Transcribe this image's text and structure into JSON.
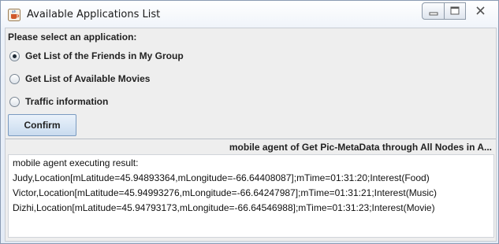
{
  "window": {
    "title": "Available Applications List",
    "icons": {
      "app": "java-coffee-cup-icon",
      "minimize": "minimize-icon",
      "maximize": "maximize-icon",
      "close": "close-icon"
    }
  },
  "form": {
    "prompt": "Please select an application:",
    "options": [
      {
        "label": "Get List of the Friends in My Group",
        "selected": true
      },
      {
        "label": "Get List of Available Movies",
        "selected": false
      },
      {
        "label": "Traffic information",
        "selected": false
      }
    ],
    "confirm_label": "Confirm"
  },
  "result_panel": {
    "title": "mobile agent of Get Pic-MetaData through All Nodes in A...",
    "lines": [
      "mobile agent executing result:",
      "Judy,Location[mLatitude=45.94893364,mLongitude=-66.64408087];mTime=01:31:20;Interest(Food)",
      "Victor,Location[mLatitude=45.94993276,mLongitude=-66.64247987];mTime=01:31:21;Interest(Music)",
      "Dizhi,Location[mLatitude=45.94793173,mLongitude=-66.64546988];mTime=01:31:23;Interest(Movie)"
    ]
  }
}
